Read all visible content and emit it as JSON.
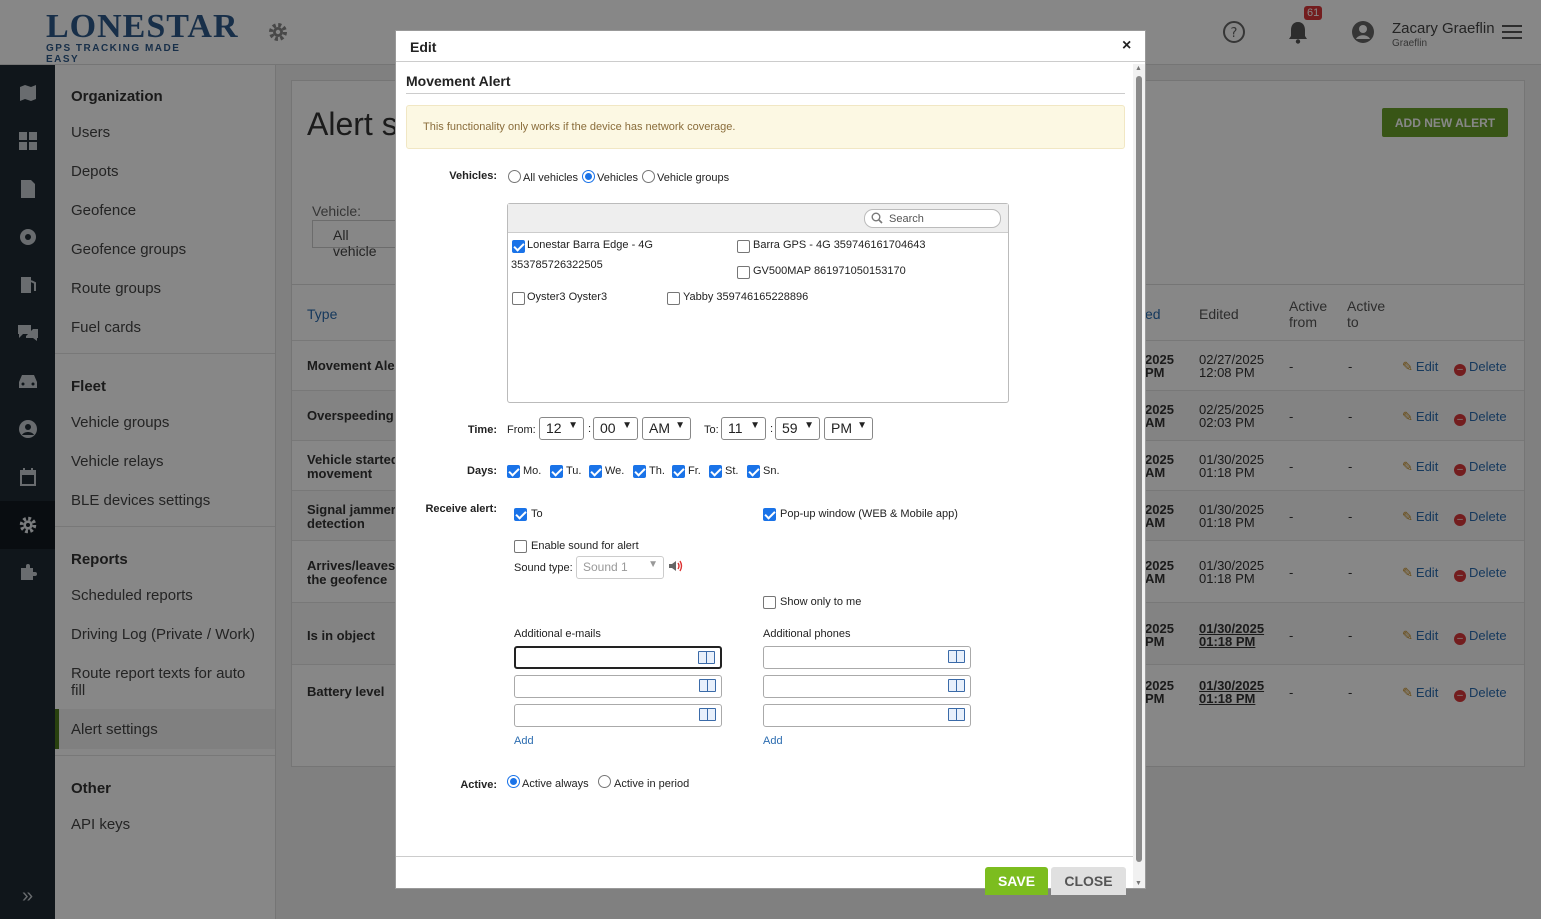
{
  "header": {
    "logo_main": "LONESTAR",
    "logo_sub": "TRACKING",
    "logo_tag": "GPS TRACKING MADE EASY",
    "notifications_count": "61",
    "user_name": "Zacary Graeflin",
    "user_sub": "Graeflin"
  },
  "nav": {
    "organization": "Organization",
    "org_items": [
      "Users",
      "Depots",
      "Geofence",
      "Geofence groups",
      "Route groups",
      "Fuel cards"
    ],
    "fleet": "Fleet",
    "fleet_items": [
      "Vehicle groups",
      "Vehicle relays",
      "BLE devices settings"
    ],
    "reports": "Reports",
    "report_items": [
      "Scheduled reports",
      "Driving Log (Private / Work)",
      "Route report texts for auto fill",
      "Alert settings"
    ],
    "other": "Other",
    "other_items": [
      "API keys"
    ]
  },
  "main": {
    "title": "Alert s",
    "add_button": "ADD NEW ALERT",
    "filter_label": "Vehicle:",
    "filter_value": "All vehicle",
    "columns": {
      "type": "Type",
      "created": "ed",
      "edited": "Edited",
      "active_from": "Active from",
      "active_to": "Active to"
    },
    "rows": [
      {
        "type": "Movement Aler",
        "created": "2025",
        "created2": "PM",
        "edited": "02/27/2025",
        "edited2": "12:08 PM",
        "from": "-",
        "to": "-"
      },
      {
        "type": "Overspeeding",
        "created": "2025",
        "created2": "AM",
        "edited": "02/25/2025",
        "edited2": "02:03 PM",
        "from": "-",
        "to": "-"
      },
      {
        "type": "Vehicle started movement",
        "created": "2025",
        "created2": "AM",
        "edited": "01/30/2025",
        "edited2": "01:18 PM",
        "from": "-",
        "to": "-"
      },
      {
        "type": "Signal jammer detection",
        "created": "2025",
        "created2": "AM",
        "edited": "01/30/2025",
        "edited2": "01:18 PM",
        "from": "-",
        "to": "-"
      },
      {
        "type": "Arrives/leaves the geofence",
        "created": "2025",
        "created2": "AM",
        "edited": "01/30/2025",
        "edited2": "01:18 PM",
        "from": "-",
        "to": "-"
      },
      {
        "type": "Is in object",
        "created": "2025",
        "created2": "PM",
        "edited": "01/30/2025",
        "edited2": "01:18 PM",
        "from": "-",
        "to": "-"
      },
      {
        "type": "Battery level",
        "created": "2025",
        "created2": "PM",
        "edited": "01/30/2025",
        "edited2": "01:18 PM",
        "from": "-",
        "to": "-"
      }
    ],
    "edit_label": "Edit",
    "delete_label": "Delete"
  },
  "modal": {
    "title": "Edit",
    "close_x": "×",
    "section": "Movement Alert",
    "warning": "This functionality only works if the device has network coverage.",
    "vehicles_label": "Vehicles:",
    "vehicle_modes": [
      "All vehicles",
      "Vehicles",
      "Vehicle groups"
    ],
    "vehicle_mode_selected": "Vehicles",
    "search_placeholder": "Search",
    "vehicles": [
      {
        "name": "Lonestar Barra Edge - 4G",
        "name2": "353785726322505",
        "checked": true
      },
      {
        "name": "Barra GPS - 4G 359746161704643",
        "checked": false
      },
      {
        "name": "GV500MAP 861971050153170",
        "checked": false
      },
      {
        "name": "Oyster3 Oyster3",
        "checked": false
      },
      {
        "name": "Yabby 359746165228896",
        "checked": false
      }
    ],
    "time_label": "Time:",
    "from_label": "From:",
    "to_label": "To:",
    "from": {
      "hour": "12",
      "min": "00",
      "ampm": "AM"
    },
    "to": {
      "hour": "11",
      "min": "59",
      "ampm": "PM"
    },
    "time_sep": ":",
    "days_label": "Days:",
    "days": [
      "Mo.",
      "Tu.",
      "We.",
      "Th.",
      "Fr.",
      "St.",
      "Sn."
    ],
    "receive_label": "Receive alert:",
    "receive_to": "To",
    "popup_label": "Pop-up window (WEB & Mobile app)",
    "sound_enable": "Enable sound for alert",
    "sound_type_label": "Sound type:",
    "sound_type_value": "Sound 1",
    "show_only_me": "Show only to me",
    "emails_label": "Additional e-mails",
    "phones_label": "Additional phones",
    "add_link": "Add",
    "active_label": "Active:",
    "active_modes": [
      "Active always",
      "Active in period"
    ],
    "active_selected": "Active always",
    "save": "SAVE",
    "close": "CLOSE"
  },
  "colors": {
    "accent_green": "#6aa12a",
    "save_green": "#7cbd1f",
    "link_blue": "#2b6cb0",
    "rail_dark": "#1f2a33"
  }
}
